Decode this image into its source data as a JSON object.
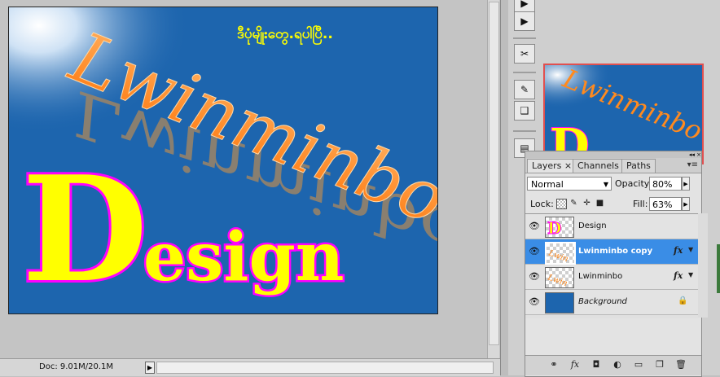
{
  "document": {
    "headline": "Lwinminbo",
    "reflection": "Lwinminbo",
    "subtitle_big_letter": "D",
    "subtitle_rest": "esign",
    "burmese_text": "ဒီပုံမျိုးတွေ.ရပါပြီ.."
  },
  "status": {
    "doc_size": "Doc: 9.01M/20.1M",
    "arrow": "▶"
  },
  "tools": [
    {
      "name": "history-icon",
      "glyph": "▶"
    },
    {
      "name": "actions-icon",
      "glyph": "▶"
    },
    {
      "name": "tool-presets-icon",
      "glyph": "✂"
    },
    {
      "name": "brushes-icon",
      "glyph": "✎"
    },
    {
      "name": "clone-source-icon",
      "glyph": "❑"
    },
    {
      "name": "notes-icon",
      "glyph": "▤"
    }
  ],
  "panel": {
    "tabs": [
      {
        "label": "Layers ×"
      },
      {
        "label": "Channels"
      },
      {
        "label": "Paths"
      }
    ],
    "menu_glyph": "▾≡",
    "collapse_glyph": "◂◂ ×",
    "blend_mode": "Normal",
    "opacity_label": "Opacity:",
    "opacity_value": "80%",
    "lock_label": "Lock:",
    "fill_label": "Fill:",
    "fill_value": "63%"
  },
  "layers": [
    {
      "name": "Design",
      "fx": "",
      "selected": false,
      "italic": false
    },
    {
      "name": "Lwinminbo copy",
      "fx": "fx",
      "selected": true,
      "italic": false
    },
    {
      "name": "Lwinminbo",
      "fx": "fx",
      "selected": false,
      "italic": false
    },
    {
      "name": "Background",
      "fx": "",
      "selected": false,
      "italic": true
    }
  ],
  "colors": {
    "canvas_blue": "#1d65ae",
    "headline_orange": "#ff8a1e",
    "design_yellow": "#ffff00",
    "design_magenta": "#ff00ff",
    "selection_blue": "#3a8de6"
  }
}
